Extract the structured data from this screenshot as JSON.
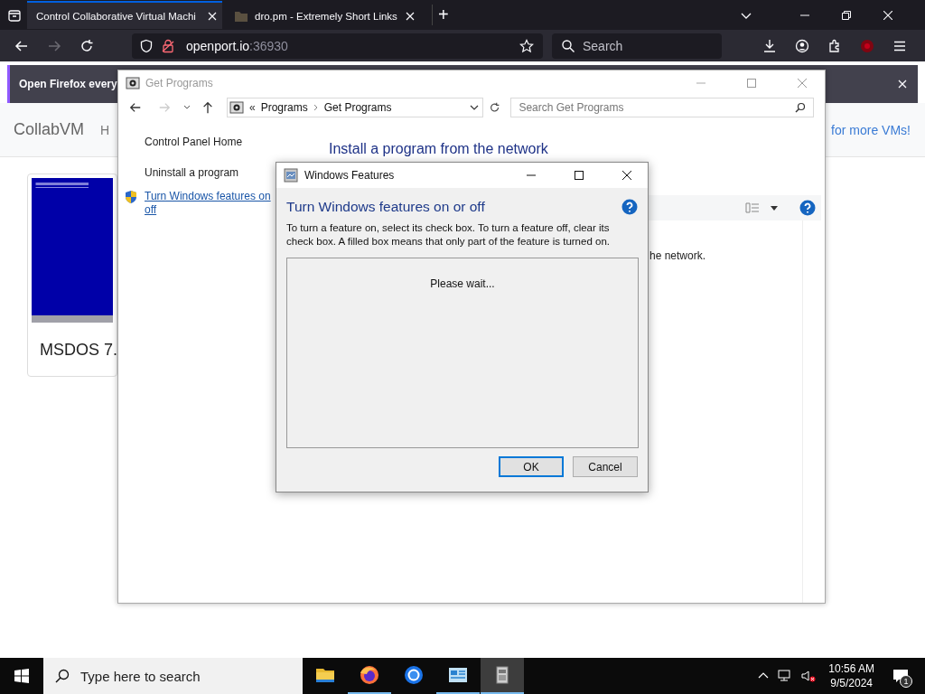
{
  "browser": {
    "tabs": [
      {
        "title": "Control Collaborative Virtual Machi",
        "selected": true,
        "kind": "plain"
      },
      {
        "title": "dro.pm - Extremely Short Links",
        "selected": false,
        "kind": "favicon"
      }
    ],
    "new_tab": "+",
    "url": {
      "host": "openport.io",
      "port": ":36930"
    },
    "search": {
      "placeholder": "Search"
    },
    "notification": {
      "text": "Open Firefox every"
    }
  },
  "page": {
    "brand": "CollabVM",
    "nav_item": "H",
    "banner_link": "for more VMs!",
    "vm_card": {
      "title": "MSDOS 7.",
      "kind": "picture"
    }
  },
  "get_programs": {
    "title": "Get Programs",
    "breadcrumb_prefix": "«",
    "breadcrumb": [
      "Programs",
      "Get Programs"
    ],
    "search": {
      "placeholder": "Search Get Programs"
    },
    "sidebar": [
      {
        "kind": "text",
        "lines": [
          "Control Panel Home"
        ]
      },
      {
        "kind": "text",
        "lines": [
          "Uninstall a program"
        ]
      },
      {
        "kind": "shield-link",
        "lines": [
          "Turn Windows features on",
          "off"
        ]
      }
    ],
    "heading": "Install a program from the network",
    "description": "he network."
  },
  "dialog": {
    "title": "Windows Features",
    "heading": "Turn Windows features on or off",
    "description": "To turn a feature on, select its check box. To turn a feature off, clear its check box. A filled box means that only part of the feature is turned on.",
    "status": "Please wait...",
    "buttons": [
      {
        "label": "OK",
        "default": true
      },
      {
        "label": "Cancel",
        "default": false
      }
    ]
  },
  "taskbar": {
    "search": {
      "placeholder": "Type here to search"
    },
    "apps": [
      {
        "kind": "folder",
        "running": false,
        "selected": false
      },
      {
        "kind": "firefox",
        "running": true,
        "selected": false
      },
      {
        "kind": "browser",
        "running": false,
        "selected": false
      },
      {
        "kind": "control-panel",
        "running": true,
        "selected": false
      },
      {
        "kind": "programs",
        "running": true,
        "selected": true
      }
    ],
    "time": "10:56 AM",
    "date": "9/5/2024",
    "notifications": "1"
  }
}
